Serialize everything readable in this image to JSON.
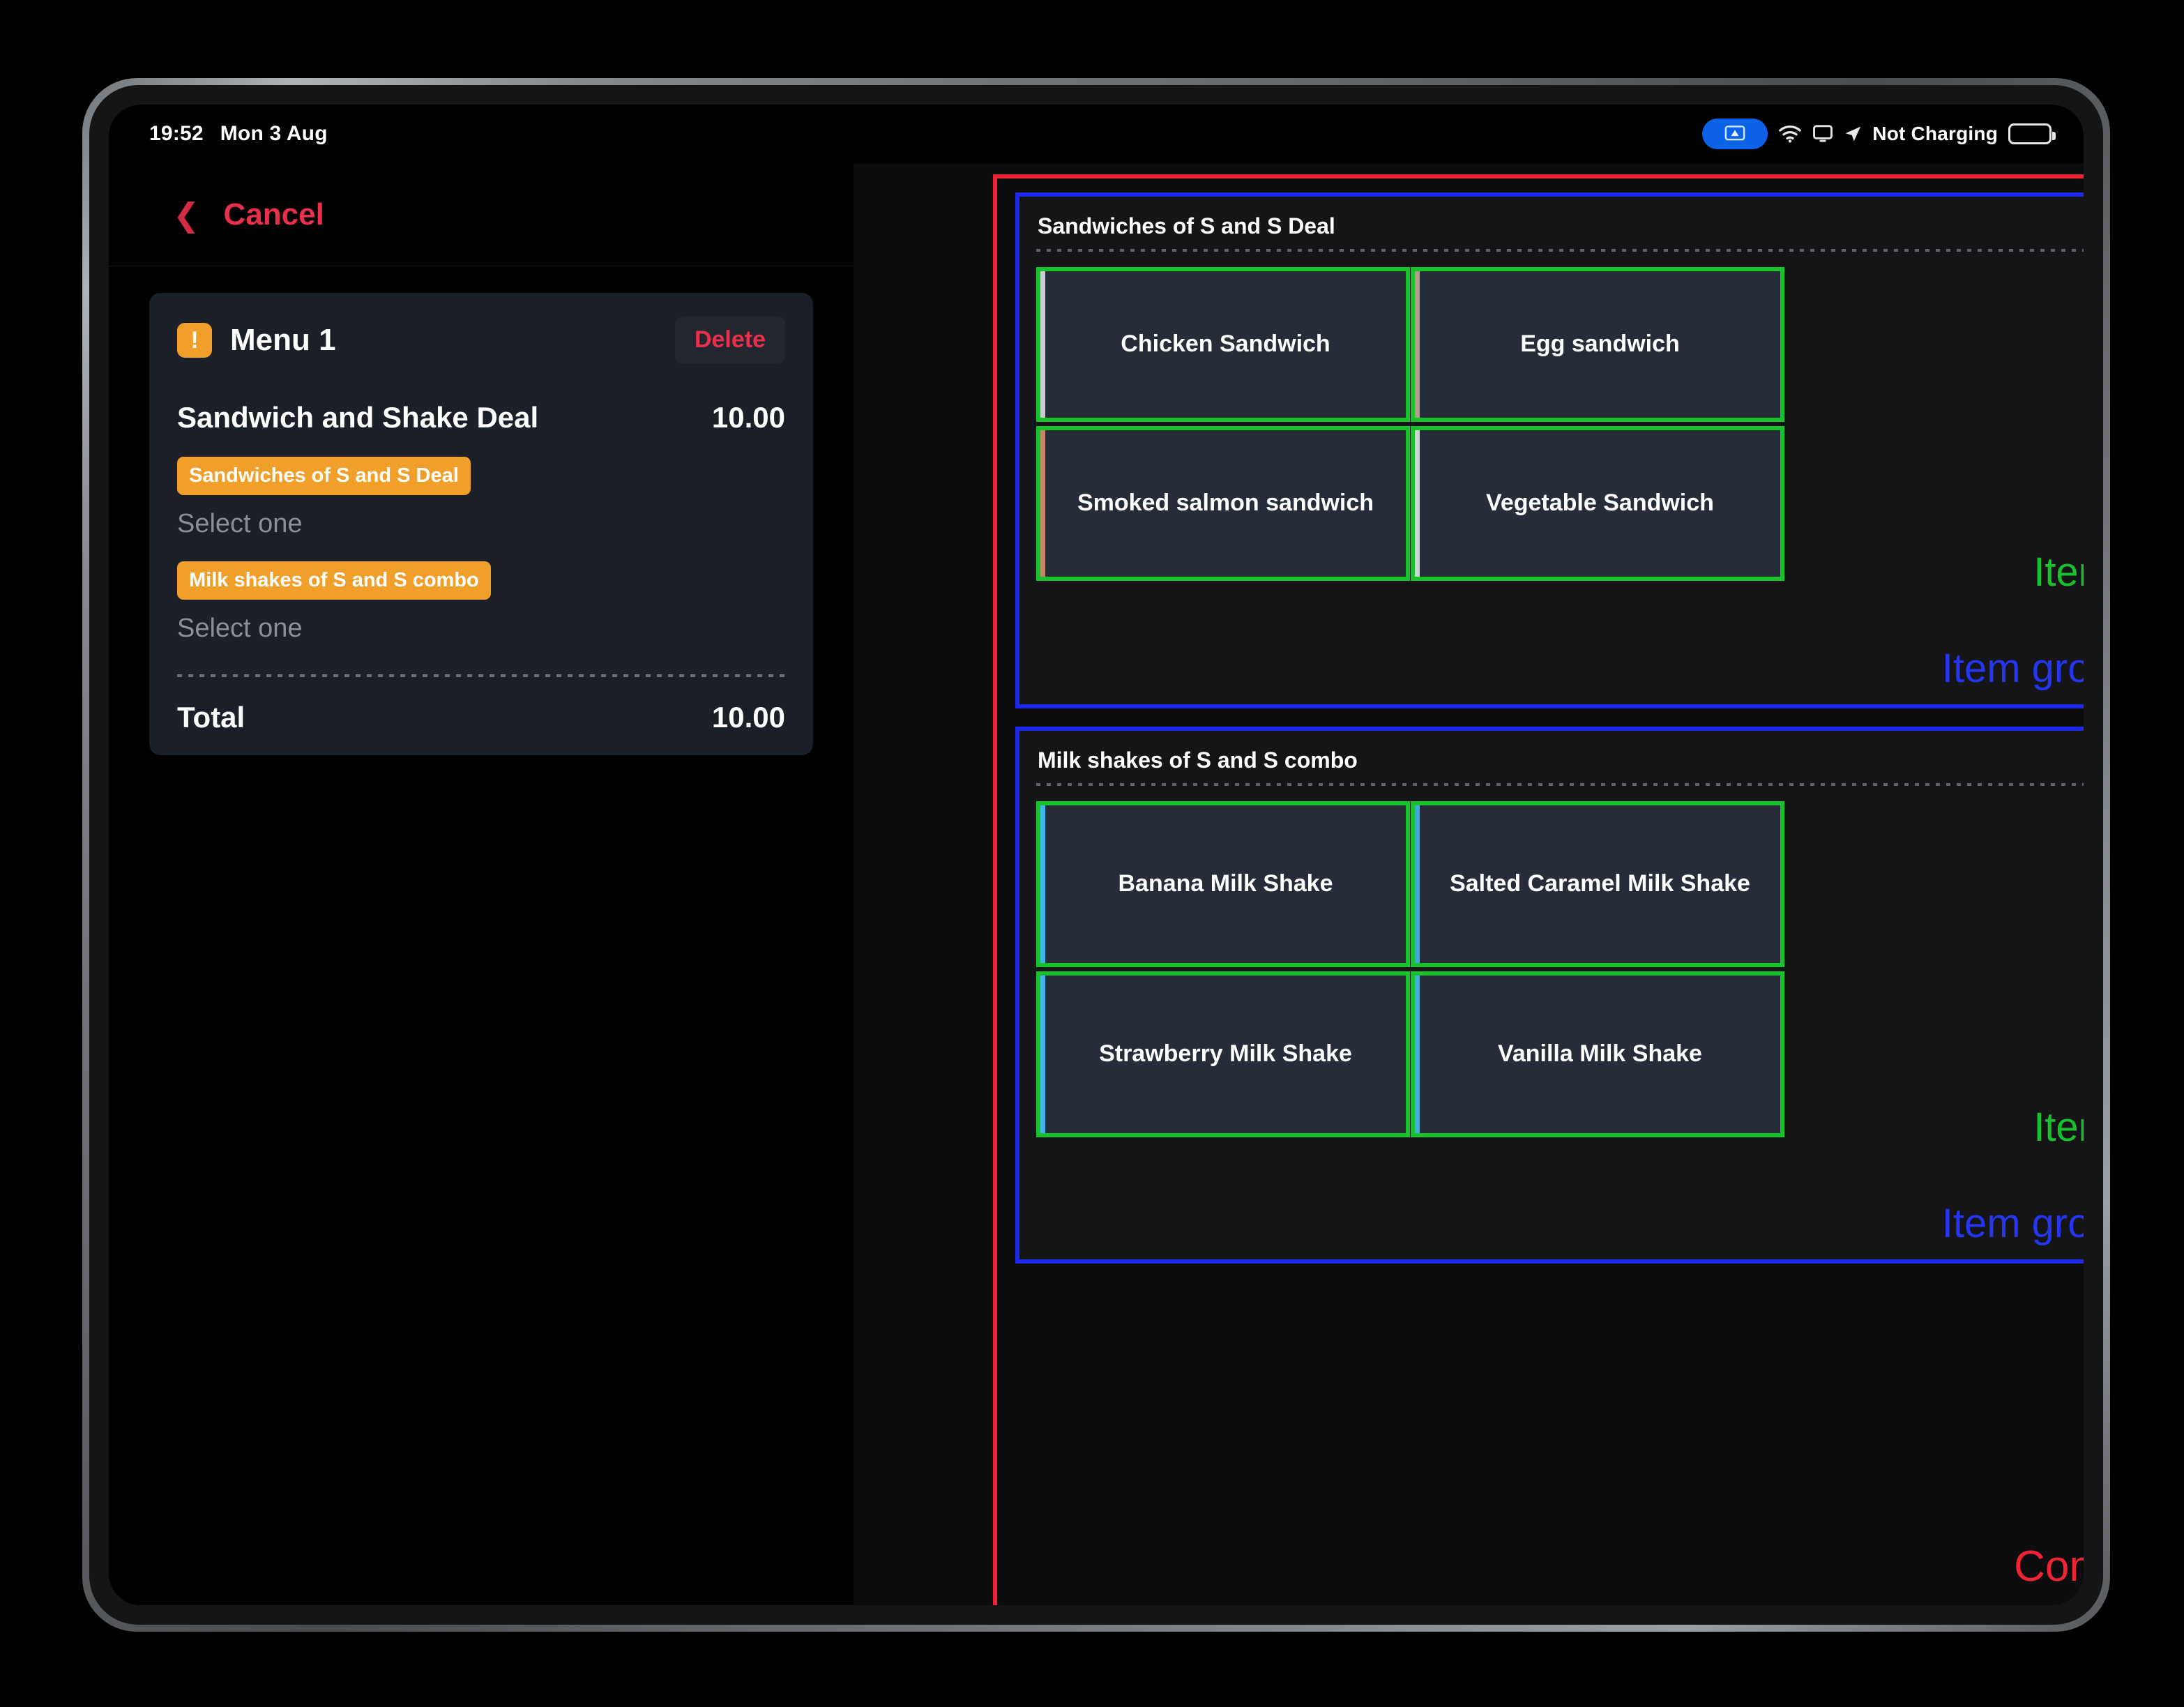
{
  "status_bar": {
    "time": "19:52",
    "date": "Mon 3 Aug",
    "mirroring_icon": "screen-mirroring-icon",
    "wifi_icon": "wifi-icon",
    "display_icon": "display-icon",
    "location_icon": "location-arrow-icon",
    "charging_text": "Not Charging",
    "battery_icon": "battery-icon"
  },
  "left_panel": {
    "nav": {
      "back_icon": "chevron-left-icon",
      "cancel_label": "Cancel"
    },
    "card": {
      "warning_icon": "warning-icon",
      "menu_title": "Menu 1",
      "delete_label": "Delete",
      "deal_name": "Sandwich and Shake Deal",
      "deal_price": "10.00",
      "groups": [
        {
          "chip": "Sandwiches of S and S Deal",
          "hint": "Select one"
        },
        {
          "chip": "Milk shakes of S and S combo",
          "hint": "Select one"
        }
      ],
      "total_label": "Total",
      "total_value": "10.00"
    }
  },
  "right_panel": {
    "annotations": {
      "combo_label": "Combo",
      "items_label": "Items",
      "item_group_label": "Item group",
      "combo_color": "#ee2434",
      "items_color": "#18c22b",
      "item_group_color": "#2536f0"
    },
    "groups": [
      {
        "title": "Sandwiches of S and S Deal",
        "items": [
          {
            "name": "Chicken Sandwich",
            "accent": "#c9ccd1"
          },
          {
            "name": "Egg sandwich",
            "accent": "#b79a88"
          },
          {
            "name": "Smoked salmon sandwich",
            "accent": "#c08a66"
          },
          {
            "name": "Vegetable Sandwich",
            "accent": "#cfd2d6"
          }
        ]
      },
      {
        "title": "Milk shakes of S and S combo",
        "items": [
          {
            "name": "Banana Milk Shake",
            "accent": "#3fb6e8"
          },
          {
            "name": "Salted Caramel Milk Shake",
            "accent": "#3fa9e8"
          },
          {
            "name": "Strawberry Milk Shake",
            "accent": "#47b3e8"
          },
          {
            "name": "Vanilla Milk Shake",
            "accent": "#3fb0e6"
          }
        ]
      }
    ]
  }
}
